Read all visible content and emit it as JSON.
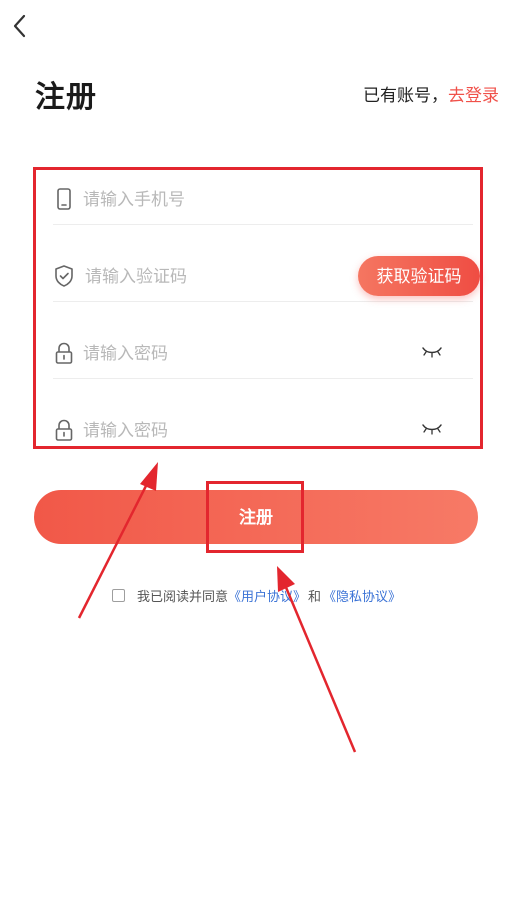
{
  "header": {
    "title": "注册",
    "login_prompt": "已有账号，",
    "login_link": "去登录"
  },
  "form": {
    "phone_placeholder": "请输入手机号",
    "code_placeholder": "请输入验证码",
    "get_code_label": "获取验证码",
    "password_placeholder": "请输入密码",
    "confirm_password_placeholder": "请输入密码"
  },
  "register_label": "注册",
  "agreement": {
    "prefix": "我已阅读并同意",
    "user_agreement": "《用户协议》",
    "and": "和",
    "privacy_policy": "《隐私协议》"
  },
  "colors": {
    "accent": "#f0514a",
    "annotation_red": "#e3262e",
    "link_blue": "#3b73d6"
  },
  "icons": [
    "back-chevron-icon",
    "phone-icon",
    "shield-check-icon",
    "lock-icon",
    "eye-closed-icon"
  ]
}
